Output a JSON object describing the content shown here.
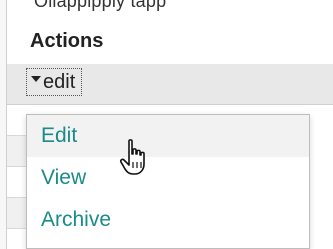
{
  "top_crop_text": "Ollapplpply tapp",
  "table": {
    "header": "Actions"
  },
  "select": {
    "value": "edit"
  },
  "menu": {
    "items": [
      {
        "label": "Edit",
        "hovered": true
      },
      {
        "label": "View",
        "hovered": false
      },
      {
        "label": "Archive",
        "hovered": false
      }
    ]
  },
  "colors": {
    "menu_text": "#1a8a8a",
    "hover_bg": "#f2f2f2",
    "row_bg": "#e8e8e8"
  },
  "icons": {
    "caret": "caret-down-icon",
    "cursor": "hand-pointer-icon"
  }
}
